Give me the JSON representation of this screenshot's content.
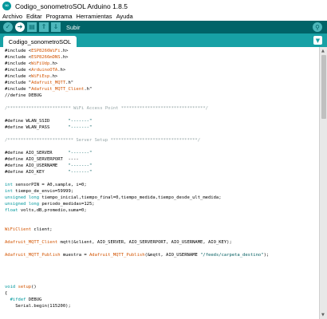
{
  "window": {
    "title": "Codigo_sonometroSOL Arduino 1.8.5",
    "icon": "arduino-logo-icon"
  },
  "menu": [
    "Archivo",
    "Editar",
    "Programa",
    "Herramientas",
    "Ayuda"
  ],
  "toolbar": {
    "hovered_label": "Subir",
    "buttons": [
      "verify-icon",
      "upload-icon",
      "new-icon",
      "open-icon",
      "save-icon"
    ],
    "serial_icon": "magnifier-icon"
  },
  "tabs": [
    {
      "label": "Codigo_sonometroSOL"
    }
  ],
  "tab_menu_icon": "chevron-down-icon",
  "colors": {
    "toolbar": "#006468",
    "tabbar": "#17a1a5",
    "keyword": "#5e6d03",
    "string": "#005c5f",
    "comment": "#95a5a6",
    "type": "#00979c",
    "orange": "#d35400"
  },
  "code": [
    {
      "k": "inc",
      "a": "#include <",
      "b": "ESP8266WiFi",
      "c": ".h>"
    },
    {
      "k": "inc",
      "a": "#include <",
      "b": "ESP8266mDNS",
      "c": ".h>"
    },
    {
      "k": "inc",
      "a": "#include <",
      "b": "WiFiUdp",
      "c": ".h>"
    },
    {
      "k": "inc",
      "a": "#include <",
      "b": "ArduinoOTA",
      "c": ".h>"
    },
    {
      "k": "inc",
      "a": "#include <",
      "b": "WiFiEsp",
      "c": ".h>"
    },
    {
      "k": "inc",
      "a": "#include \"",
      "b": "Adafruit_MQTT",
      "c": ".h\""
    },
    {
      "k": "inc",
      "a": "#include \"",
      "b": "Adafruit_MQTT_Client",
      "c": ".h\""
    },
    {
      "k": "plain",
      "a": "//define DEBUG"
    },
    {
      "k": "blank"
    },
    {
      "k": "com",
      "a": "/************************ WiFi Access Point ********************************/"
    },
    {
      "k": "blank"
    },
    {
      "k": "def",
      "a": "#define WLAN_SSID       ",
      "b": "\"-------\""
    },
    {
      "k": "def",
      "a": "#define WLAN_PASS       ",
      "b": "\"-------\""
    },
    {
      "k": "blank"
    },
    {
      "k": "com",
      "a": "/************************* Server Setup *********************************/"
    },
    {
      "k": "blank"
    },
    {
      "k": "def",
      "a": "#define AIO_SERVER      ",
      "b": "\"-------\""
    },
    {
      "k": "plain",
      "a": "#define AIO_SERVERPORT  ----"
    },
    {
      "k": "def",
      "a": "#define AIO_USERNAME    ",
      "b": "\"-------\""
    },
    {
      "k": "def",
      "a": "#define AIO_KEY         ",
      "b": "\"-------\""
    },
    {
      "k": "blank"
    },
    {
      "k": "decl",
      "a": "int",
      "b": " sensorPIN = A0,sample, i=0;"
    },
    {
      "k": "decl",
      "a": "int",
      "b": " tiempo_de_envio=59999;"
    },
    {
      "k": "decl",
      "a": "unsigned long",
      "b": " tiempo_inicial,tiempo_final=0,tiempo_medida,tiempo_desde_ult_medida;"
    },
    {
      "k": "decl",
      "a": "unsigned long",
      "b": " periodo_medidas=125;"
    },
    {
      "k": "decl",
      "a": "float",
      "b": " volts,dB,promedio,suma=0;"
    },
    {
      "k": "blank"
    },
    {
      "k": "blank"
    },
    {
      "k": "cls",
      "a": "WiFiClient",
      "b": " client;"
    },
    {
      "k": "blank"
    },
    {
      "k": "mq",
      "a": "Adafruit_MQTT_Client",
      "b": " mqtt(&client, AIO_SERVER, AIO_SERVERPORT, AIO_USERNAME, AIO_KEY);"
    },
    {
      "k": "blank"
    },
    {
      "k": "pub",
      "a": "Adafruit_MQTT_Publish",
      "b": " muestra = ",
      "c": "Adafruit_MQTT_Publish",
      "d": "(&mqtt, AIO_USERNAME ",
      "e": "\"/feeds/carpeta_destino\"",
      "f": ");"
    },
    {
      "k": "blank"
    },
    {
      "k": "blank"
    },
    {
      "k": "blank"
    },
    {
      "k": "blank"
    },
    {
      "k": "fn",
      "a": "void",
      "b": " ",
      "c": "setup",
      "d": "()"
    },
    {
      "k": "plain",
      "a": "{"
    },
    {
      "k": "kwline",
      "a": "  #ifdef",
      "b": " DEBUG"
    },
    {
      "k": "plain",
      "a": "    Serial.begin(115200);"
    }
  ]
}
